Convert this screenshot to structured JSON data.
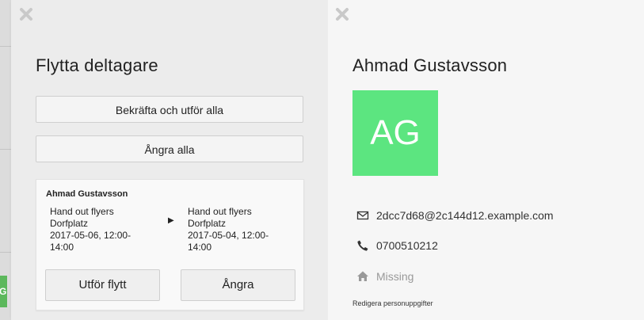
{
  "left_panel": {
    "title": "Flytta deltagare",
    "confirm_all_label": "Bekräfta och utför alla",
    "undo_all_label": "Ångra alla",
    "move_card": {
      "participant_name": "Ahmad Gustavsson",
      "from": {
        "task": "Hand out flyers",
        "location": "Dorfplatz",
        "datetime_line1": "2017-05-06, 12:00-",
        "datetime_line2": "14:00"
      },
      "to": {
        "task": "Hand out flyers",
        "location": "Dorfplatz",
        "datetime_line1": "2017-05-04, 12:00-",
        "datetime_line2": "14:00"
      },
      "execute_label": "Utför flytt",
      "undo_label": "Ångra"
    }
  },
  "right_panel": {
    "name": "Ahmad Gustavsson",
    "initials": "AG",
    "email": "2dcc7d68@2c144d12.example.com",
    "phone": "0700510212",
    "address": "Missing",
    "edit_label": "Redigera personuppgifter"
  },
  "background": {
    "badge_text": "G"
  },
  "colors": {
    "avatar_bg": "#5ce580",
    "badge_bg": "#5cb85c"
  }
}
